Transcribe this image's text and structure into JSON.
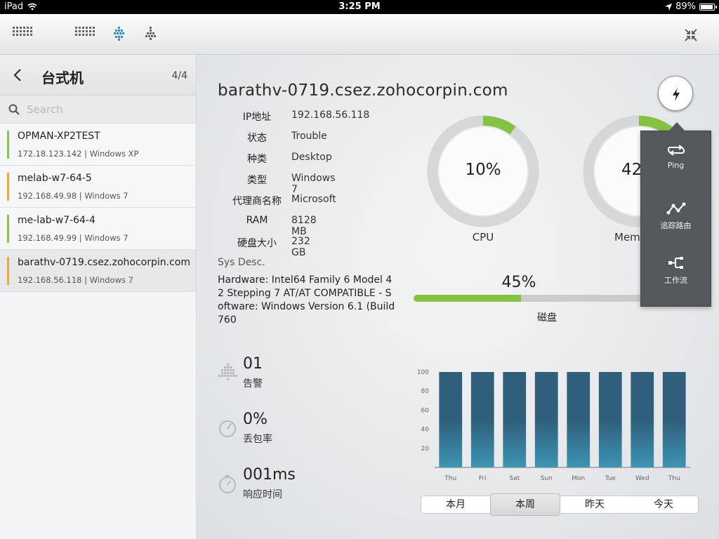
{
  "status_bar": {
    "device": "iPad",
    "time": "3:25 PM",
    "battery": "89%"
  },
  "toolbar": {
    "icons": [
      "grid-dots-icon",
      "grid-small-icon",
      "map-cross-icon",
      "tree-icon",
      "collapse-icon"
    ]
  },
  "sidebar": {
    "title": "台式机",
    "count": "4/4",
    "search_placeholder": "Search",
    "items": [
      {
        "name": "OPMAN-XP2TEST",
        "meta": "172.18.123.142 | Windows XP",
        "status_color": "#8cc34a"
      },
      {
        "name": "melab-w7-64-5",
        "meta": "192.168.49.98 | Windows 7",
        "status_color": "#f0a73a"
      },
      {
        "name": "me-lab-w7-64-4",
        "meta": "192.168.49.99 | Windows 7",
        "status_color": "#8cc34a"
      },
      {
        "name": "barathv-0719.csez.zohocorpin.com",
        "meta": "192.168.56.118 | Windows 7",
        "status_color": "#f0a73a"
      }
    ]
  },
  "device": {
    "hostname": "barathv-0719.csez.zohocorpin.com",
    "properties": [
      {
        "key": "IP地址",
        "value": "192.168.56.118"
      },
      {
        "key": "状态",
        "value": "Trouble"
      },
      {
        "key": "种类",
        "value": "Desktop"
      },
      {
        "key": "类型",
        "value": "Windows 7"
      },
      {
        "key": "代理商名称",
        "value": "Microsoft"
      },
      {
        "key": "RAM",
        "value": "8128 MB"
      },
      {
        "key": "硬盘大小",
        "value": "232 GB"
      }
    ],
    "sys_desc_label": "Sys Desc.",
    "sys_desc_value": "Hardware: Intel64 Family 6 Model 42 Stepping 7 AT/AT COMPATIBLE - Software: Windows Version 6.1 (Build 760"
  },
  "gauges": [
    {
      "label": "CPU",
      "value_text": "10%",
      "value": 10
    },
    {
      "label": "Mem",
      "value_text": "42",
      "value": 42
    }
  ],
  "disk": {
    "label": "磁盘",
    "value_text": "45%",
    "value": 45
  },
  "stats": [
    {
      "value": "01",
      "label": "告警",
      "icon": "alarm-grid-icon"
    },
    {
      "value": "0%",
      "label": "丢包率",
      "icon": "gauge-icon"
    },
    {
      "value": "001ms",
      "label": "响应时间",
      "icon": "timer-icon"
    }
  ],
  "chart_data": {
    "type": "bar",
    "categories": [
      "Thu",
      "Fri",
      "Sat",
      "Sun",
      "Mon",
      "Tue",
      "Wed",
      "Thu"
    ],
    "values": [
      100,
      100,
      100,
      100,
      100,
      100,
      100,
      100
    ],
    "ylim": [
      0,
      100
    ],
    "yticks": [
      20,
      40,
      60,
      80,
      100
    ],
    "bar_color": "#3a7391"
  },
  "range_tabs": {
    "items": [
      "本月",
      "本周",
      "昨天",
      "今天"
    ],
    "active": "本周"
  },
  "popover": {
    "items": [
      {
        "label": "Ping",
        "icon": "ping-icon"
      },
      {
        "label": "追踪路由",
        "icon": "traceroute-icon"
      },
      {
        "label": "工作流",
        "icon": "workflow-icon"
      }
    ]
  },
  "colors": {
    "accent_green": "#84c341",
    "gauge_track": "#d8d9da",
    "popover_bg": "#55585b"
  }
}
